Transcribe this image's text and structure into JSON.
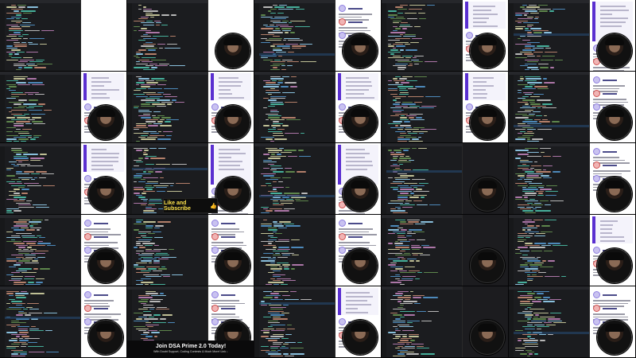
{
  "video": {
    "type": "contact-sheet",
    "rows": 5,
    "columns": 5
  },
  "overlays": {
    "like_subscribe": {
      "text": "Like and Subscribe",
      "icon": "thumbs-up-icon"
    },
    "join_banner": {
      "title": "Join DSA Prime 2.0 Today!",
      "subtitle": "With Doubt Support, Coding Contests & Much More! Link ↓"
    }
  },
  "colors": {
    "editor_bg": "#1b1c1f",
    "chat_pane_bg": "#ffffff",
    "accent_purple": "#5a2fd0",
    "banner_text": "#ffe44d"
  }
}
